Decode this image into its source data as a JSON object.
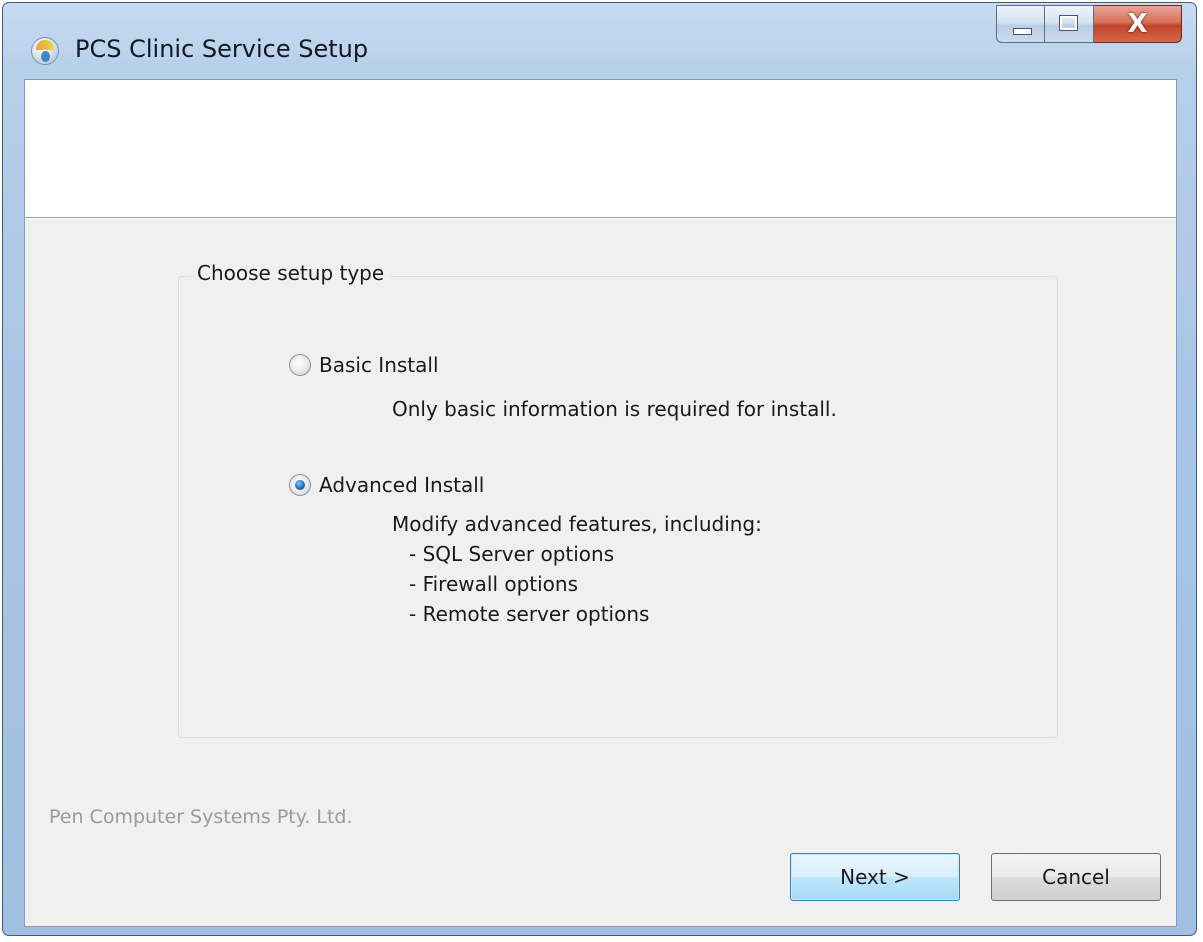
{
  "window": {
    "title": "PCS Clinic Service Setup",
    "app_icon": "pcs-app-icon",
    "controls": {
      "minimize_icon": "minimize-icon",
      "maximize_icon": "maximize-icon",
      "close_glyph": "X"
    }
  },
  "group": {
    "legend": "Choose setup type"
  },
  "options": [
    {
      "label": "Basic Install",
      "checked": false,
      "description": "Only basic information is required for install."
    },
    {
      "label": "Advanced Install",
      "checked": true,
      "description": "Modify advanced features, including:",
      "features": [
        "- SQL Server options",
        "- Firewall options",
        "- Remote server options"
      ]
    }
  ],
  "footer": {
    "company": "Pen Computer Systems Pty. Ltd.",
    "next_label": "Next >",
    "cancel_label": "Cancel"
  },
  "colors": {
    "default_button_border": "#3c7fb1",
    "close_button": "#c2422a",
    "radio_selected": "#1f6fc0"
  }
}
